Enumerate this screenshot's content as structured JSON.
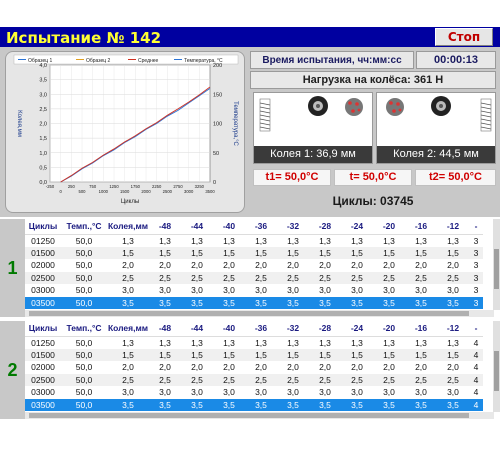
{
  "header": {
    "title": "Испытание № 142",
    "stop_label": "Стоп"
  },
  "colors": {
    "title_bg": "#0000a0",
    "title_fg": "#ffff33",
    "series_sample1": "#2b74d6",
    "series_sample2": "#e0a020",
    "series_mean": "#d03020",
    "series_temp": "#2b74d6",
    "selected_row": "#1a8ae6",
    "section_label": "#007a00",
    "temp_text": "#d00000"
  },
  "status": {
    "time_label": "Время испытания, чч:мм:сс",
    "time_value": "00:00:13",
    "load_text": "Нагрузка на колёса:  361 Н",
    "wheel1_caption": "Колея 1: 36,9 мм",
    "wheel2_caption": "Колея 2: 44,5 мм",
    "t1": "t1=  50,0°C",
    "t_mid": "t= 50,0°C",
    "t2": "t2= 50,0°C",
    "cycles": "Циклы: 03745"
  },
  "chart_data": {
    "type": "line",
    "legend": [
      "Образец 1",
      "Образец 2",
      "Среднее",
      "Температура, °C"
    ],
    "xlabel": "Циклы",
    "ylabel": "Колея,мм",
    "y2label": "Температура,°C",
    "x_ticks": [
      "-250",
      "250",
      "750",
      "1250",
      "1750",
      "2250",
      "2750",
      "3250"
    ],
    "x_ticks_minor": [
      "0",
      "500",
      "1000",
      "1500",
      "2000",
      "2500",
      "3000",
      "3500"
    ],
    "y_ticks": [
      "0,0",
      "0,5",
      "1,0",
      "1,5",
      "2,0",
      "2,5",
      "3,0",
      "3,5",
      "4,0"
    ],
    "y2_ticks": [
      "0",
      "50",
      "100",
      "150",
      "200"
    ],
    "xlim": [
      -250,
      3500
    ],
    "ylim": [
      0,
      4
    ],
    "y2lim": [
      0,
      200
    ],
    "grid": true,
    "legend_position": "top",
    "x": [
      0,
      250,
      500,
      750,
      1000,
      1250,
      1500,
      1750,
      2000,
      2250,
      2500,
      2750,
      3000,
      3250,
      3500
    ],
    "series": [
      {
        "name": "Образец 1",
        "values": [
          0.0,
          0.2,
          0.45,
          0.65,
          0.9,
          1.1,
          1.35,
          1.55,
          1.8,
          2.0,
          2.25,
          2.45,
          2.7,
          2.95,
          3.2
        ]
      },
      {
        "name": "Среднее",
        "values": [
          0.0,
          0.22,
          0.47,
          0.67,
          0.92,
          1.13,
          1.37,
          1.58,
          1.82,
          2.03,
          2.28,
          2.5,
          2.73,
          2.98,
          3.25
        ]
      }
    ]
  },
  "table_headers": [
    "Циклы",
    "Темп.,°C",
    "Колея,мм",
    "-48",
    "-44",
    "-40",
    "-36",
    "-32",
    "-28",
    "-24",
    "-20",
    "-16",
    "-12",
    "-"
  ],
  "sections": [
    {
      "label": "1",
      "rows": [
        [
          "01250",
          "50,0",
          "1,3",
          "1,3",
          "1,3",
          "1,3",
          "1,3",
          "1,3",
          "1,3",
          "1,3",
          "1,3",
          "1,3",
          "1,3",
          "3"
        ],
        [
          "01500",
          "50,0",
          "1,5",
          "1,5",
          "1,5",
          "1,5",
          "1,5",
          "1,5",
          "1,5",
          "1,5",
          "1,5",
          "1,5",
          "1,5",
          "3"
        ],
        [
          "02000",
          "50,0",
          "2,0",
          "2,0",
          "2,0",
          "2,0",
          "2,0",
          "2,0",
          "2,0",
          "2,0",
          "2,0",
          "2,0",
          "2,0",
          "3"
        ],
        [
          "02500",
          "50,0",
          "2,5",
          "2,5",
          "2,5",
          "2,5",
          "2,5",
          "2,5",
          "2,5",
          "2,5",
          "2,5",
          "2,5",
          "2,5",
          "3"
        ],
        [
          "03000",
          "50,0",
          "3,0",
          "3,0",
          "3,0",
          "3,0",
          "3,0",
          "3,0",
          "3,0",
          "3,0",
          "3,0",
          "3,0",
          "3,0",
          "3"
        ],
        [
          "03500",
          "50,0",
          "3,5",
          "3,5",
          "3,5",
          "3,5",
          "3,5",
          "3,5",
          "3,5",
          "3,5",
          "3,5",
          "3,5",
          "3,5",
          "3"
        ]
      ]
    },
    {
      "label": "2",
      "rows": [
        [
          "01250",
          "50,0",
          "1,3",
          "1,3",
          "1,3",
          "1,3",
          "1,3",
          "1,3",
          "1,3",
          "1,3",
          "1,3",
          "1,3",
          "1,3",
          "4"
        ],
        [
          "01500",
          "50,0",
          "1,5",
          "1,5",
          "1,5",
          "1,5",
          "1,5",
          "1,5",
          "1,5",
          "1,5",
          "1,5",
          "1,5",
          "1,5",
          "4"
        ],
        [
          "02000",
          "50,0",
          "2,0",
          "2,0",
          "2,0",
          "2,0",
          "2,0",
          "2,0",
          "2,0",
          "2,0",
          "2,0",
          "2,0",
          "2,0",
          "4"
        ],
        [
          "02500",
          "50,0",
          "2,5",
          "2,5",
          "2,5",
          "2,5",
          "2,5",
          "2,5",
          "2,5",
          "2,5",
          "2,5",
          "2,5",
          "2,5",
          "4"
        ],
        [
          "03000",
          "50,0",
          "3,0",
          "3,0",
          "3,0",
          "3,0",
          "3,0",
          "3,0",
          "3,0",
          "3,0",
          "3,0",
          "3,0",
          "3,0",
          "4"
        ],
        [
          "03500",
          "50,0",
          "3,5",
          "3,5",
          "3,5",
          "3,5",
          "3,5",
          "3,5",
          "3,5",
          "3,5",
          "3,5",
          "3,5",
          "3,5",
          "4"
        ]
      ]
    }
  ]
}
